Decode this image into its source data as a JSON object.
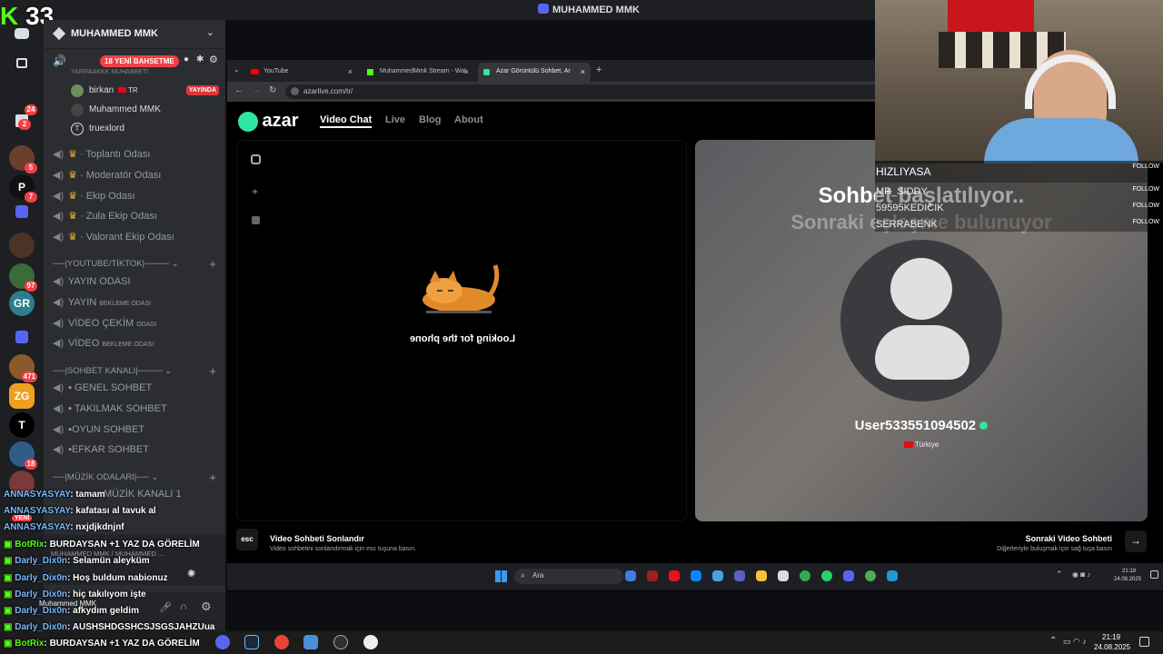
{
  "window": {
    "title": "MUHAMMED MMK"
  },
  "overlay": {
    "counter": "33"
  },
  "rail": {
    "badges": [
      "24",
      "2",
      "5",
      "7",
      "97",
      "471",
      "18"
    ]
  },
  "server": {
    "name": "MUHAMMED MMK",
    "promo_badge": "18 YENİ BAHSETME",
    "sub_label": "YARRAAKKK MUHABBETİ",
    "voice_users": [
      {
        "name": "birkan",
        "tag": "TR",
        "live": "YAYINDA"
      },
      {
        "name": "Muhammed MMK"
      },
      {
        "name": "truexlord"
      }
    ],
    "channels_top": [
      "Toplantı Odası",
      "Moderatör Odası",
      "Ekip Odası",
      "Zula Ekip Odası",
      "Valorant Ekip Odası"
    ],
    "cat_youtube": "|YOUTUBE/TİKTOK|",
    "youtube_channels": [
      {
        "name": "YAYIN ODASI",
        "small": ""
      },
      {
        "name": "YAYIN",
        "small": "BEKLEME ODASI"
      },
      {
        "name": "VİDEO ÇEKİM",
        "small": "ODASI"
      },
      {
        "name": "VİDEO",
        "small": "BEKLEME ODASI"
      }
    ],
    "cat_sohbet": "|SOHBET KANALI|",
    "sohbet_channels": [
      "GENEL SOHBET",
      "TAKILMAK SOHBET",
      "OYUN SOHBET",
      "EFKAR SOHBET"
    ],
    "cat_muzik": "|MÜZİK ODALARI|",
    "muzik_channel": "MÜZİK KANALI 1",
    "yeni": "YENİ",
    "voice_panel": "MUHAMMED MMK / MUHAMMED ...",
    "user_panel_name": "Muhammed MMK"
  },
  "chat": [
    {
      "user": "ANNASYASYAY",
      "msg": "tamam"
    },
    {
      "user": "ANNASYASYAY",
      "msg": "kafatası al tavuk al"
    },
    {
      "user": "ANNASYASYAY",
      "msg": "nxjdjkdnjnf"
    },
    {
      "user": "BotRix",
      "msg": "BURDAYSAN +1 YAZ DA GÖRELİM"
    },
    {
      "user": "Darly_Dix0n",
      "msg": "Selamün aleyküm"
    },
    {
      "user": "Darly_Dix0n",
      "msg": "Hoş buldum nabionuz"
    },
    {
      "user": "Darly_Dix0n",
      "msg": "hiç takılıyom işte"
    },
    {
      "user": "Darly_Dix0n",
      "msg": "afkydım geldim"
    },
    {
      "user": "Darly_Dix0n",
      "msg": "AUSHSHDGSHCSJSGSJAHZUua"
    },
    {
      "user": "BotRix",
      "msg": "BURDAYSAN +1 YAZ DA GÖRELİM"
    }
  ],
  "browser": {
    "tabs": [
      "YouTube",
      "MuhammedMmk Stream - Wat",
      "Azar Görüntülü Sohbet, Ar"
    ],
    "url": "azarlive.com/tr/",
    "logo": "azar",
    "nav": [
      "Video Chat",
      "Live",
      "Blog",
      "About"
    ],
    "looking": "Looking for the phone",
    "sohbet_title": "Sohbet başlatılıyor..",
    "sohbet_sub": "Sonraki eşleşme bulunuyor",
    "username": "User533551094502",
    "country": "Türkiye",
    "esc_key": "esc",
    "end_title": "Video Sohbeti Sonlandır",
    "end_sub": "Video sohbetini sonlandırmak için esc tuşuna basın.",
    "next_title": "Sonraki Video Sohbeti",
    "next_sub": "Diğerleriyle buluşmak için sağ tuşa basın"
  },
  "inner_taskbar": {
    "search": "Ara",
    "time": "21:19",
    "date": "24.08.2025"
  },
  "os_taskbar": {
    "time": "21:19",
    "date": "24.08.2025"
  },
  "followers": {
    "title": "HIZLIYASA",
    "follow": "FOLLOW",
    "names": [
      "MR_SIDDY",
      "59595KEDICIK",
      "SERRABENK"
    ]
  }
}
